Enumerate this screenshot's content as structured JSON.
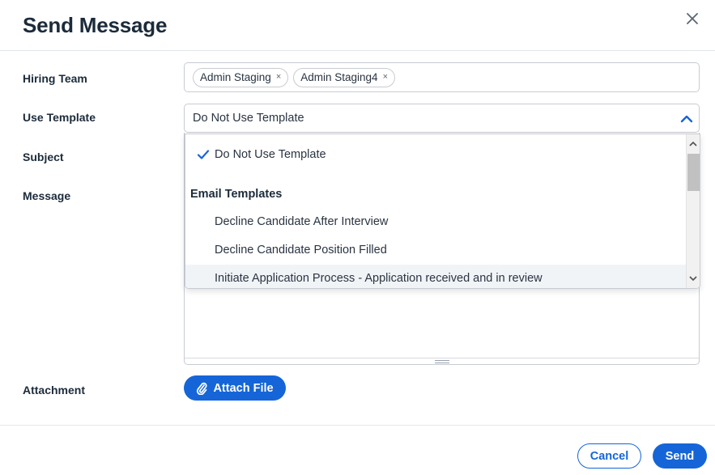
{
  "modal": {
    "title": "Send Message",
    "close_icon": "close-icon"
  },
  "fields": {
    "hiring_team_label": "Hiring Team",
    "use_template_label": "Use Template",
    "subject_label": "Subject",
    "message_label": "Message",
    "attachment_label": "Attachment"
  },
  "hiring_team": {
    "chips": [
      {
        "label": "Admin Staging",
        "remove": "×"
      },
      {
        "label": "Admin Staging4",
        "remove": "×"
      }
    ]
  },
  "template_select": {
    "selected": "Do Not Use Template",
    "icon": "chevron-up-icon",
    "options": {
      "none": "Do Not Use Template",
      "group_label": "Email Templates",
      "items": [
        "Decline Candidate After Interview",
        "Decline Candidate Position Filled",
        "Initiate Application Process - Application received and in review"
      ]
    }
  },
  "attachment": {
    "button_label": "Attach File",
    "icon": "paperclip-icon"
  },
  "footer": {
    "cancel_label": "Cancel",
    "send_label": "Send"
  },
  "colors": {
    "primary": "#1565d8",
    "text": "#1c2b3a",
    "border": "#c7ccd3"
  }
}
